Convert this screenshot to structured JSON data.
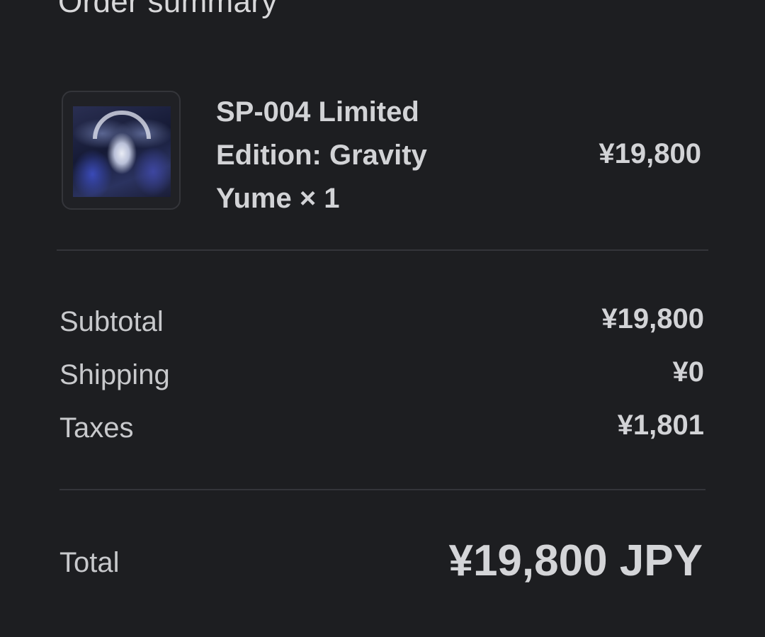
{
  "header": {
    "title": "Order summary"
  },
  "item": {
    "name": "SP-004 Limited Edition: Gravity Yume × 1",
    "price": "¥19,800"
  },
  "summary": {
    "subtotal_label": "Subtotal",
    "subtotal_value": "¥19,800",
    "shipping_label": "Shipping",
    "shipping_value": "¥0",
    "taxes_label": "Taxes",
    "taxes_value": "¥1,801"
  },
  "total": {
    "label": "Total",
    "value": "¥19,800 JPY"
  }
}
